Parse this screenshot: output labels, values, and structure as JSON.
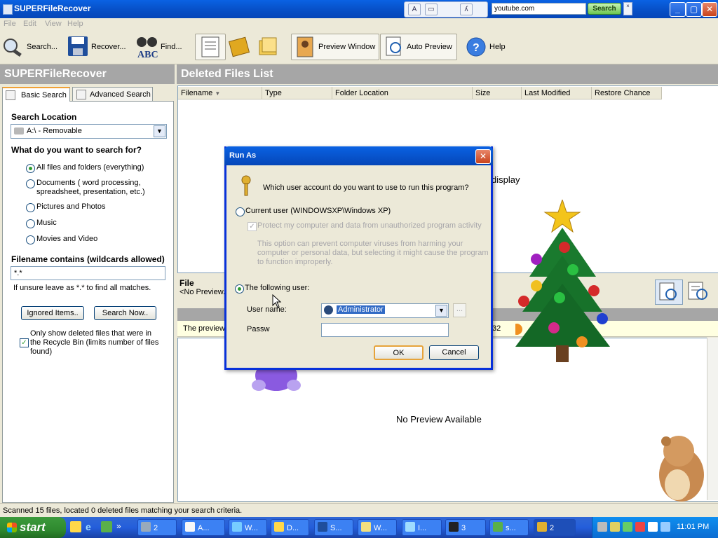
{
  "app": {
    "title": "SUPERFileRecover"
  },
  "ie_bar": {
    "url_value": "youtube.com",
    "search_label": "Search"
  },
  "menu": [
    "File",
    "Edit",
    "View",
    "Help"
  ],
  "toolbar": {
    "search": "Search...",
    "recover": "Recover...",
    "find": "Find...",
    "preview_window": "Preview Window",
    "auto_preview": "Auto Preview",
    "help": "Help"
  },
  "left": {
    "header": "SUPERFileRecover",
    "tabs": [
      "Basic Search",
      "Advanced Search"
    ],
    "search_location_label": "Search Location",
    "search_location_value": "A:\\ - Removable",
    "what_label": "What do you want to search for?",
    "options": [
      "All files and folders (everything)",
      "Documents ( word processing,",
      "spreadsheet, presentation, etc.)",
      "Pictures and Photos",
      "Music",
      "Movies and Video"
    ],
    "filename_label": "Filename contains (wildcards allowed)",
    "filename_value": "*.*",
    "filename_hint": "If unsure leave as *.* to find all matches.",
    "ignored_items": "Ignored Items..",
    "search_now": "Search Now..",
    "recycle_lines": [
      "Only show deleted files that were in",
      "the Recycle Bin (limits number of files",
      "found)"
    ]
  },
  "right": {
    "header": "Deleted Files List",
    "columns": [
      "Filename",
      "Type",
      "Folder Location",
      "Size",
      "Last Modified",
      "Restore Chance"
    ],
    "display_fragment": "display",
    "file_label": "File",
    "no_preview_short": "<No Preview...",
    "preview_notice": "The preview",
    "preview_fragment": "32",
    "no_preview": "No Preview Available"
  },
  "status": "Scanned 15 files, located 0 deleted files matching your search criteria.",
  "dialog": {
    "title": "Run As",
    "question": "Which user account do you want to use to run this program?",
    "current_user": "Current user (WINDOWSXP\\Windows XP)",
    "protect": "Protect my computer and data from unauthorized program activity",
    "protect_note": [
      "This option can prevent computer viruses from harming your",
      "computer or personal data, but selecting it might cause the program",
      "to function improperly."
    ],
    "following_user": "The following user:",
    "username_label": "User name:",
    "username_value": "Administrator",
    "password_label": "Passw",
    "ok": "OK",
    "cancel": "Cancel",
    "browse": "..."
  },
  "taskbar": {
    "start": "start",
    "tasks": [
      "2",
      "A...",
      "W...",
      "D...",
      "S...",
      "W...",
      "I...",
      "3",
      "s...",
      "2"
    ],
    "clock": "11:01 PM"
  },
  "colors": {
    "xp_blue": "#0a62e3",
    "header_gray": "#a6a6a6",
    "start_green": "#3c9a3c"
  }
}
